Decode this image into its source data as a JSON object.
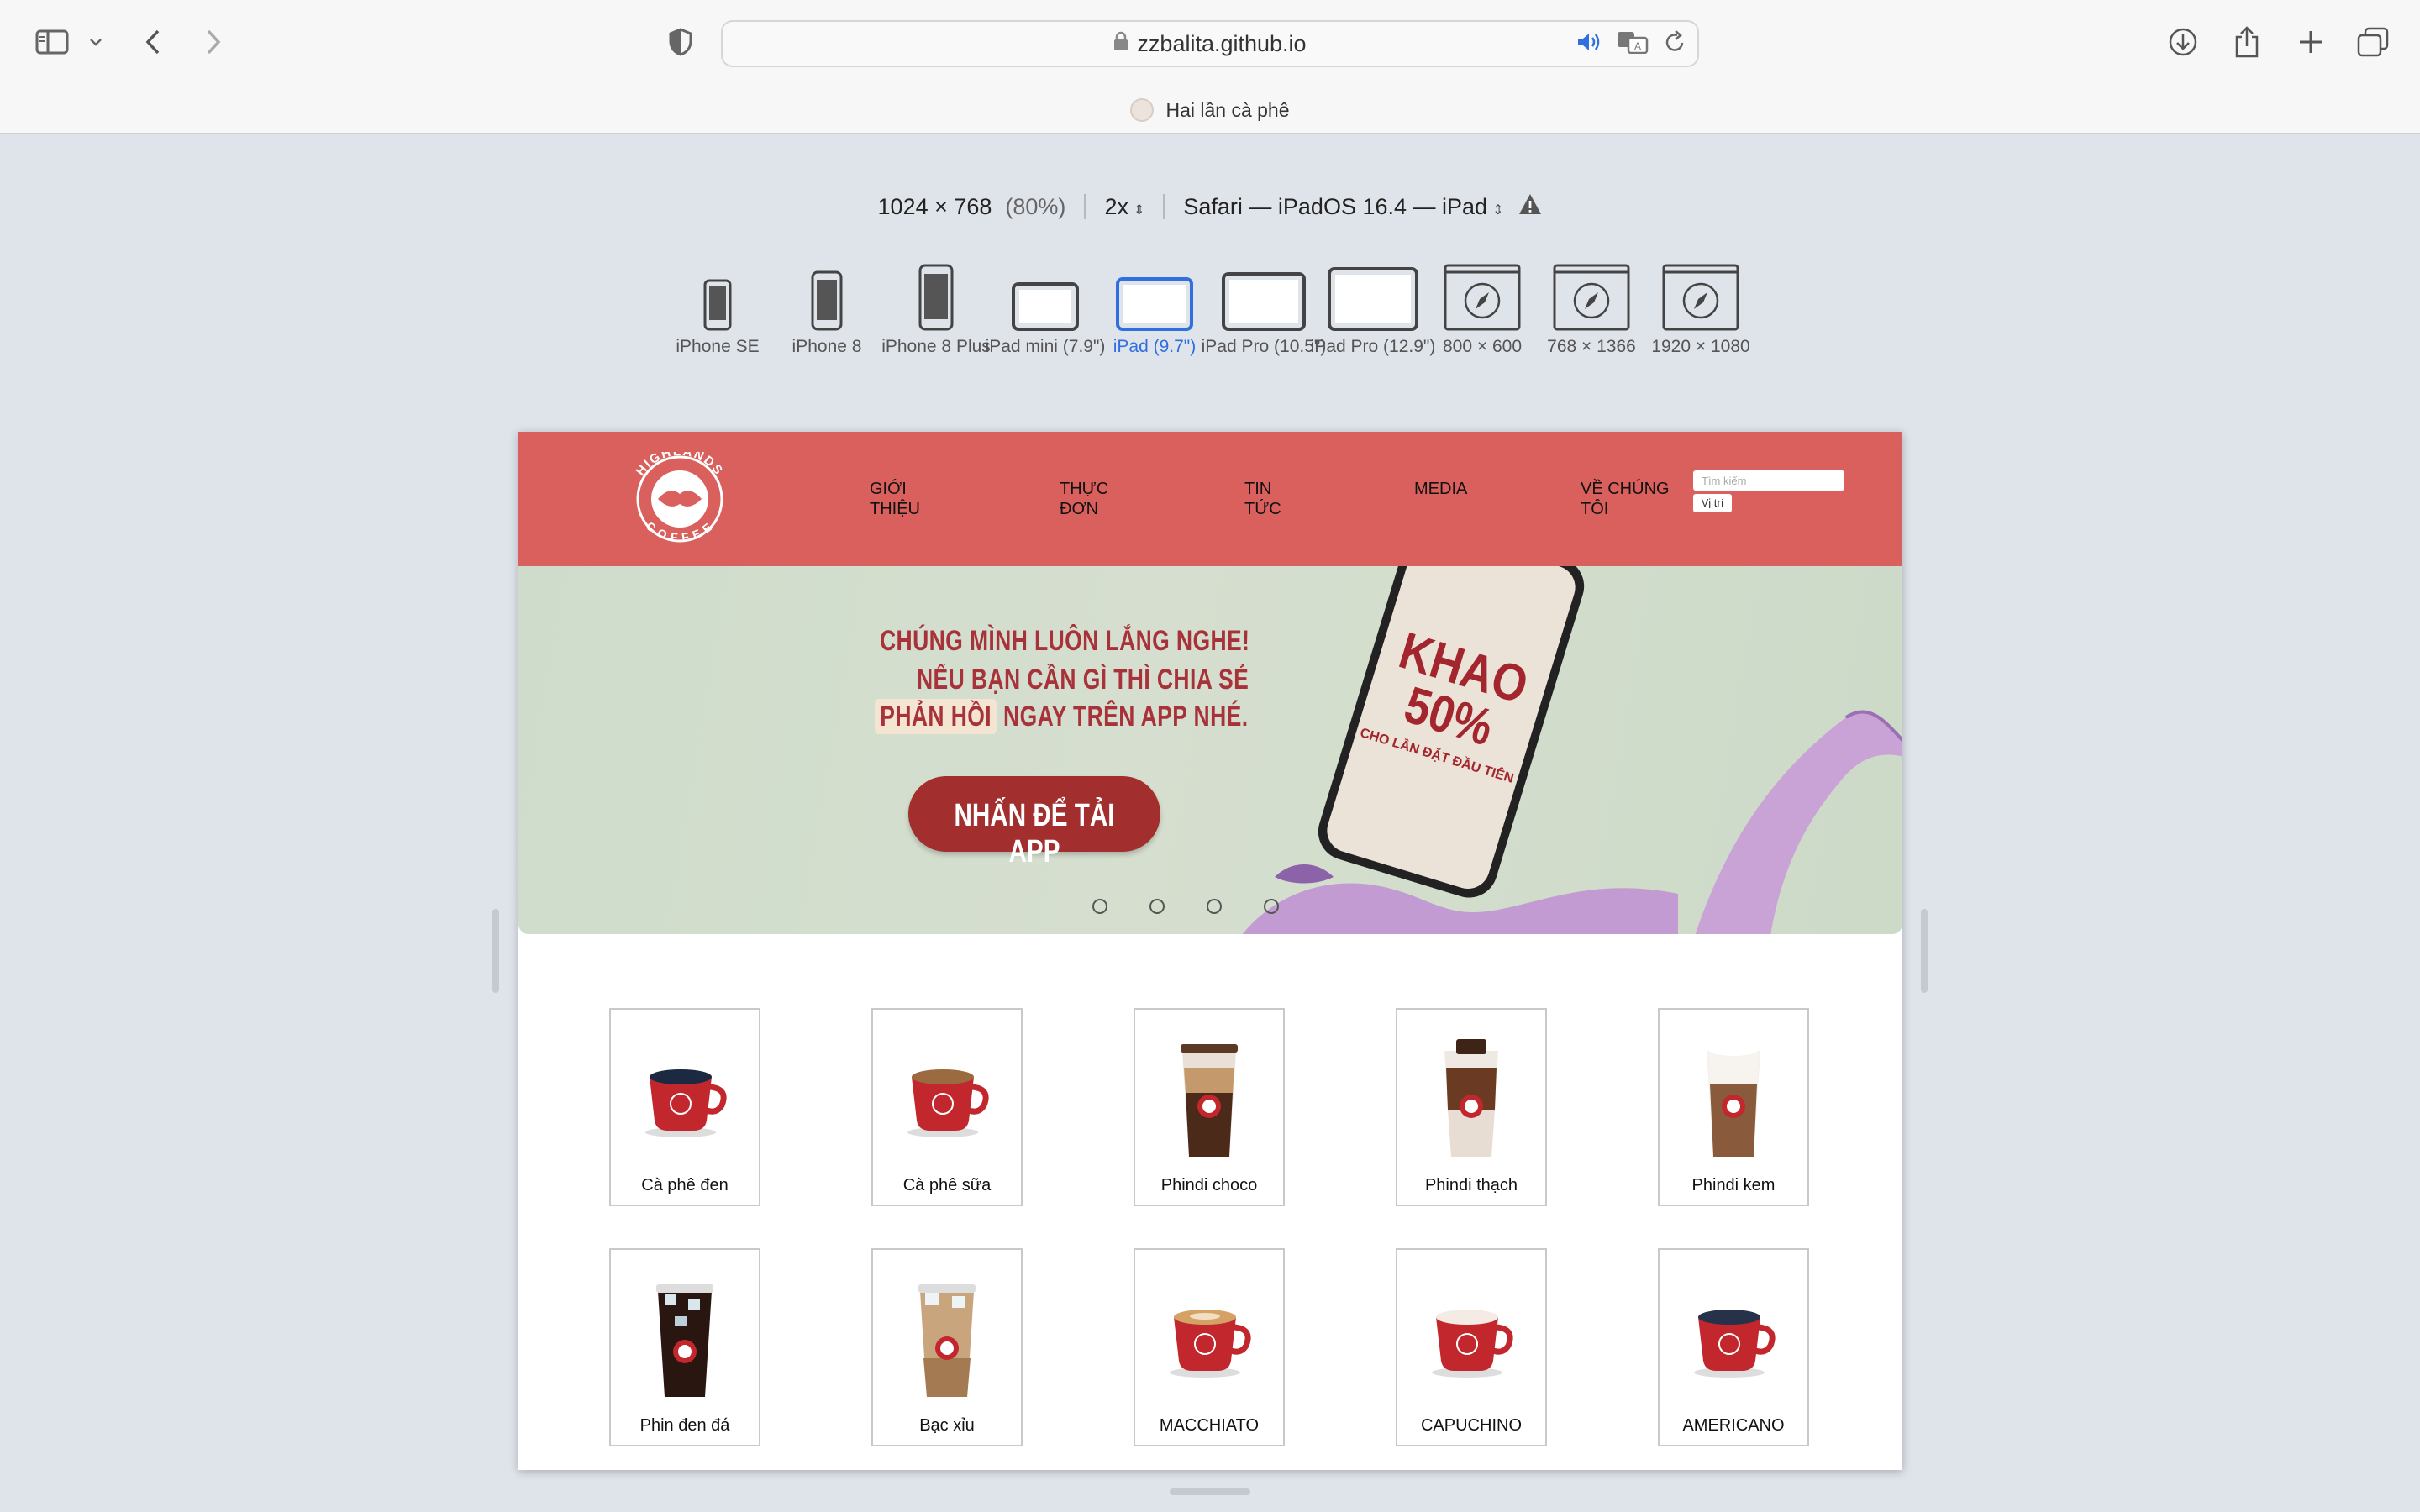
{
  "browser": {
    "url": "zzbalita.github.io",
    "tab_title": "Hai lần cà phê"
  },
  "rdm": {
    "dimensions": "1024 × 768",
    "scale_percent": "(80%)",
    "pixel_ratio": "2x",
    "user_agent": "Safari — iPadOS 16.4 — iPad",
    "devices": [
      {
        "label": "iPhone SE",
        "icon": "phone-icon"
      },
      {
        "label": "iPhone 8",
        "icon": "phone-icon"
      },
      {
        "label": "iPhone 8 Plus",
        "icon": "phone-icon"
      },
      {
        "label": "iPad mini (7.9\")",
        "icon": "tablet-icon"
      },
      {
        "label": "iPad (9.7\")",
        "icon": "tablet-icon",
        "active": true
      },
      {
        "label": "iPad Pro (10.5\")",
        "icon": "tablet-icon"
      },
      {
        "label": "iPad Pro (12.9\")",
        "icon": "tablet-icon"
      },
      {
        "label": "800 × 600",
        "icon": "compass-window-icon"
      },
      {
        "label": "768 × 1366",
        "icon": "compass-window-icon"
      },
      {
        "label": "1920 × 1080",
        "icon": "compass-window-icon"
      }
    ]
  },
  "site": {
    "logo_text_top": "HIGHLANDS",
    "logo_text_bottom": "COFFEE",
    "nav": [
      "GIỚI THIỆU",
      "THỰC ĐƠN",
      "TIN TỨC",
      "MEDIA",
      "VỀ CHÚNG TÔI"
    ],
    "search_placeholder": "Tìm kiếm",
    "location_button": "Vị trí",
    "banner": {
      "line1": "CHÚNG MÌNH LUÔN LẮNG NGHE!",
      "line2": "NẾU BẠN CẦN GÌ THÌ CHIA SẺ",
      "line3_highlight": "PHẢN HỒI",
      "line3_rest": "NGAY TRÊN APP NHÉ.",
      "cta": "NHẤN ĐỂ TẢI APP",
      "phone_big": "KHAO 50%",
      "phone_small": "CHO LẦN ĐẶT ĐẦU TIÊN"
    },
    "products": [
      {
        "name": "Cà phê đen",
        "type": "cup"
      },
      {
        "name": "Cà phê sữa",
        "type": "cup"
      },
      {
        "name": "Phindi choco",
        "type": "glass"
      },
      {
        "name": "Phindi thạch",
        "type": "glass"
      },
      {
        "name": "Phindi kem",
        "type": "glass"
      },
      {
        "name": "Phin đen đá",
        "type": "glass"
      },
      {
        "name": "Bạc xỉu",
        "type": "glass"
      },
      {
        "name": "MACCHIATO",
        "type": "cup"
      },
      {
        "name": "CAPUCHINO",
        "type": "cup"
      },
      {
        "name": "AMERICANO",
        "type": "cup"
      }
    ]
  },
  "colors": {
    "header_red": "#d9605c",
    "brand_dark_red": "#a22e2d",
    "active_blue": "#2f6fe0"
  }
}
